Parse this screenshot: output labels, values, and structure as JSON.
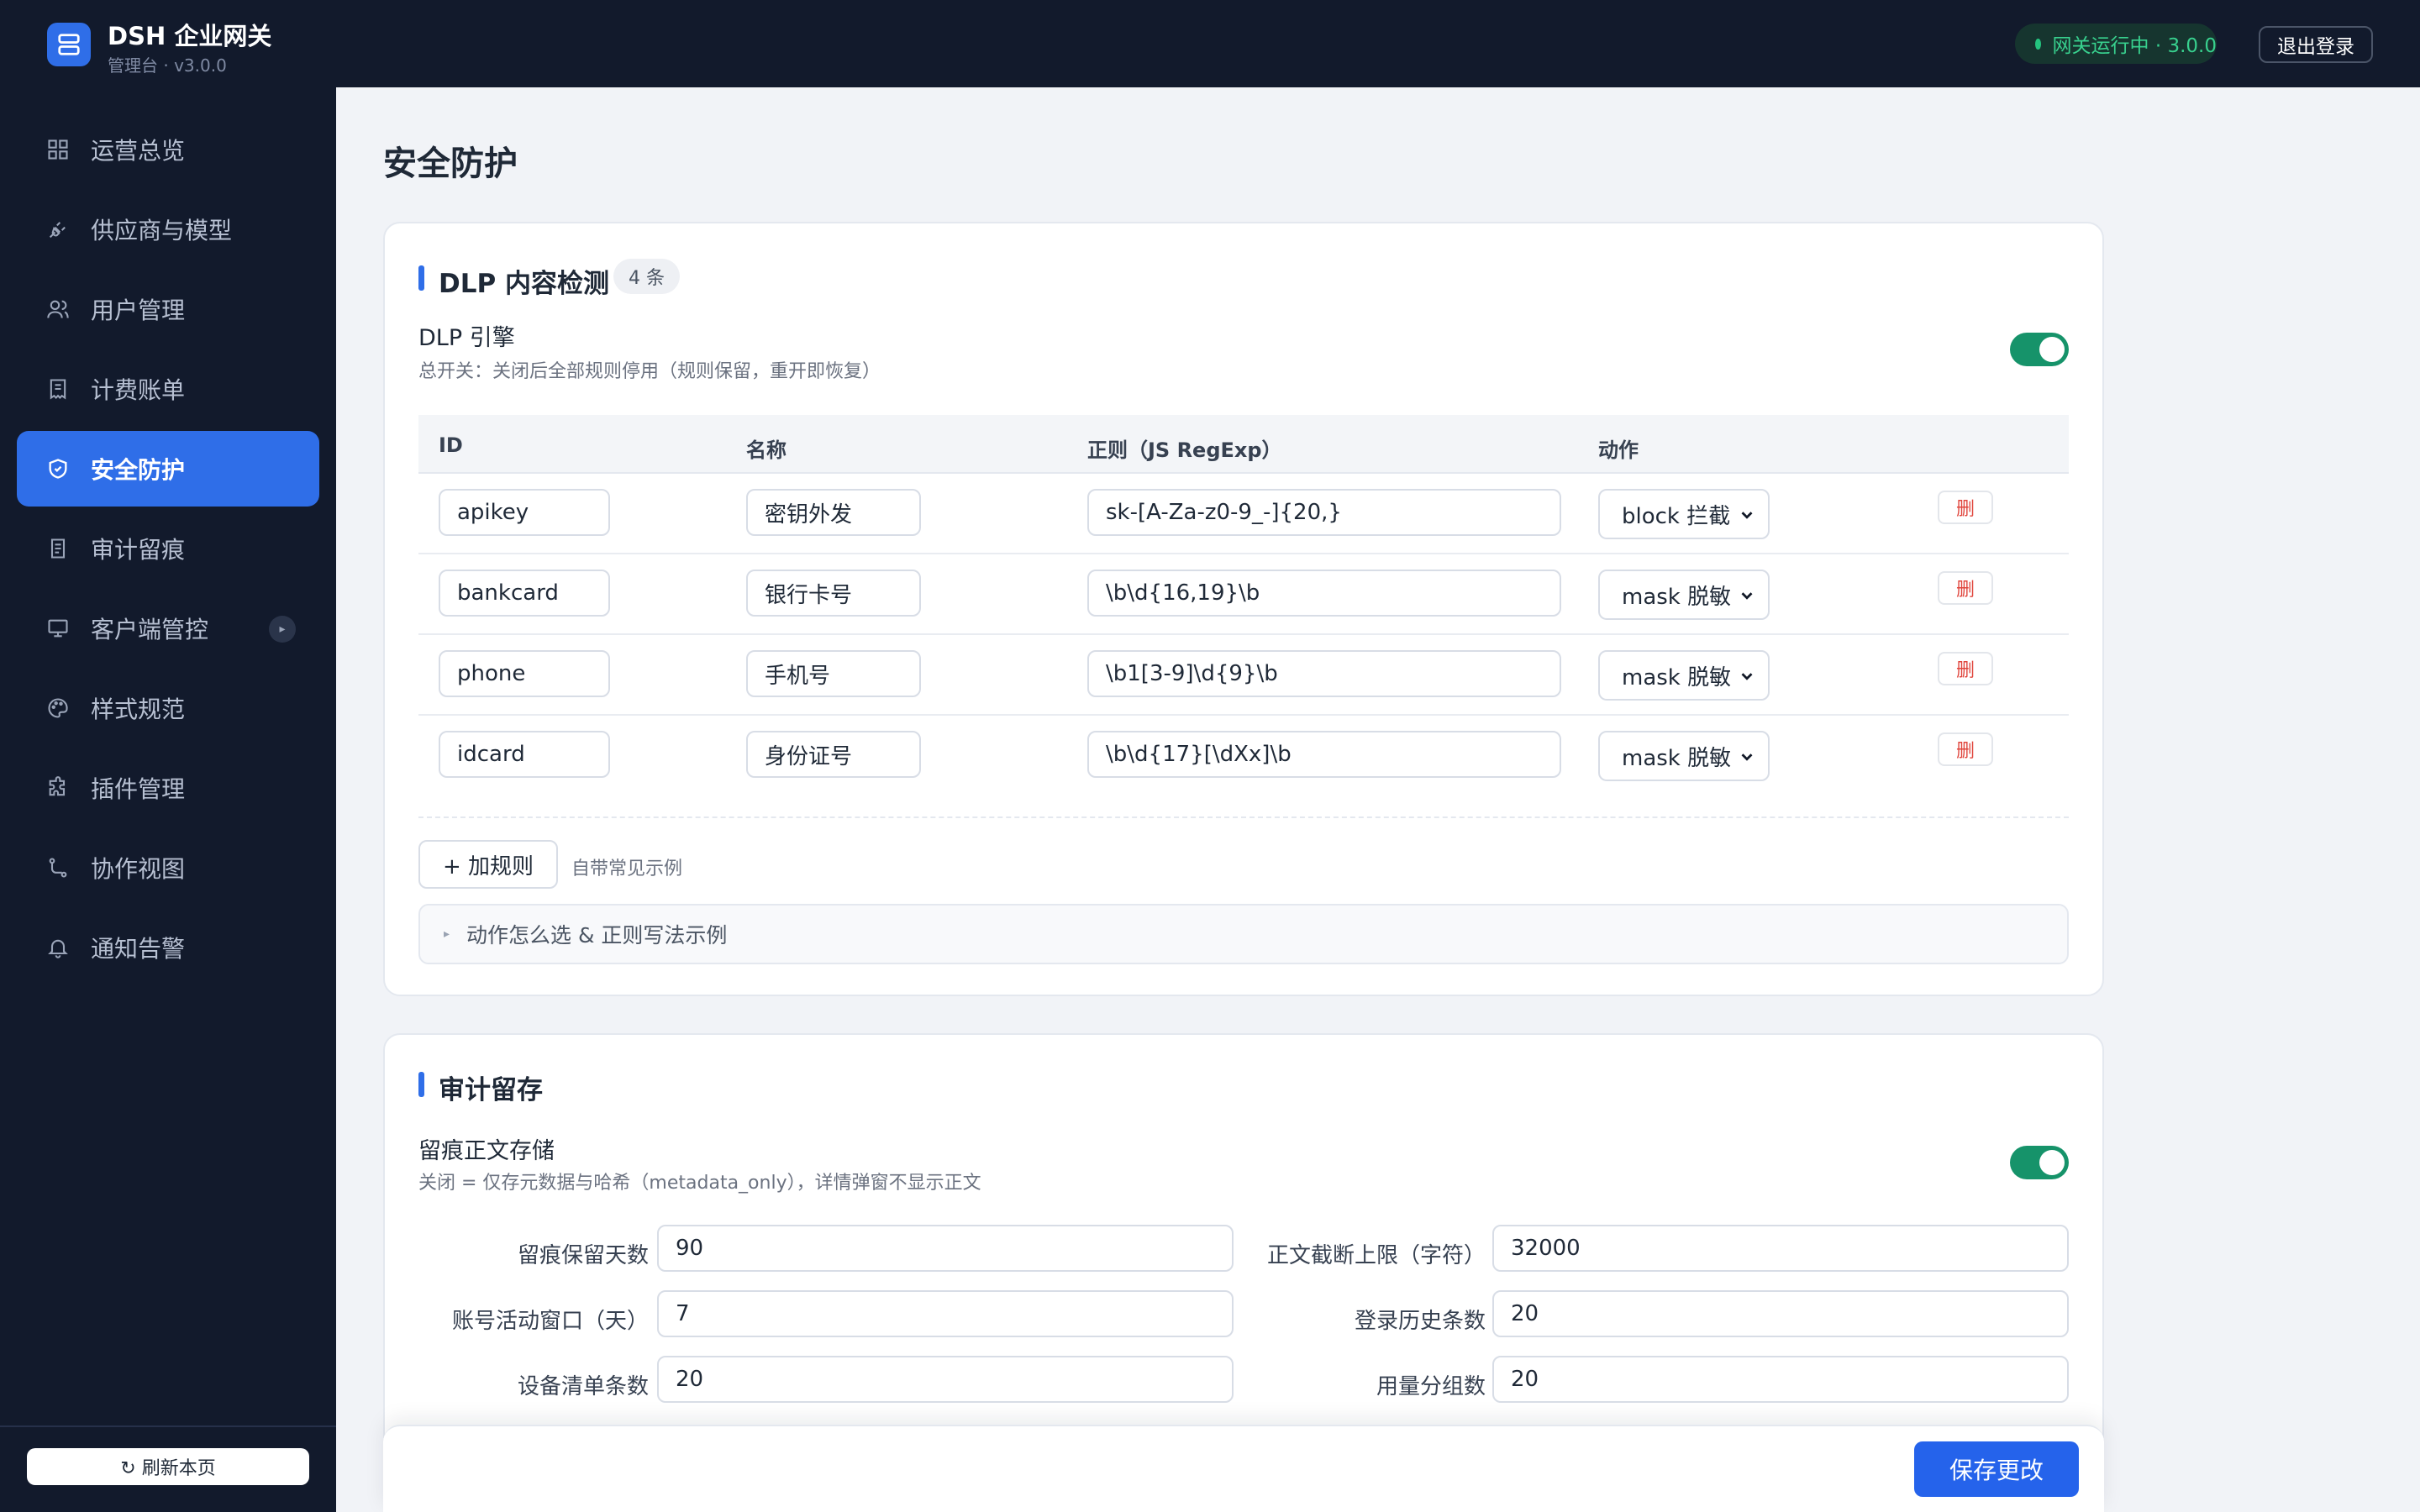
{
  "app": {
    "title": "DSH 企业网关",
    "subtitle": "管理台 · v3.0.0"
  },
  "header": {
    "status": "网关运行中 · 3.0.0",
    "logout": "退出登录"
  },
  "sidebar": {
    "items": [
      {
        "label": "运营总览",
        "icon": "dashboard-icon"
      },
      {
        "label": "供应商与模型",
        "icon": "plug-icon"
      },
      {
        "label": "用户管理",
        "icon": "users-icon"
      },
      {
        "label": "计费账单",
        "icon": "receipt-icon"
      },
      {
        "label": "安全防护",
        "icon": "shield-icon",
        "active": true
      },
      {
        "label": "审计留痕",
        "icon": "audit-icon"
      },
      {
        "label": "客户端管控",
        "icon": "monitor-icon",
        "badge": "▸"
      },
      {
        "label": "样式规范",
        "icon": "palette-icon"
      },
      {
        "label": "插件管理",
        "icon": "puzzle-icon"
      },
      {
        "label": "协作视图",
        "icon": "route-icon"
      },
      {
        "label": "通知告警",
        "icon": "bell-icon"
      }
    ],
    "refresh": "↻ 刷新本页"
  },
  "page": {
    "title": "安全防护"
  },
  "dlp": {
    "title": "DLP 内容检测",
    "count": "4 条",
    "engine_label": "DLP 引擎",
    "engine_desc": "总开关：关闭后全部规则停用（规则保留，重开即恢复）",
    "engine_enabled": true,
    "columns": {
      "id": "ID",
      "name": "名称",
      "regex": "正则（JS RegExp）",
      "action": "动作"
    },
    "rules": [
      {
        "id": "apikey",
        "name": "密钥外发",
        "regex": "sk-[A-Za-z0-9_-]{20,}",
        "action": "block 拦截",
        "delete": "删"
      },
      {
        "id": "bankcard",
        "name": "银行卡号",
        "regex": "\\b\\d{16,19}\\b",
        "action": "mask 脱敏",
        "delete": "删"
      },
      {
        "id": "phone",
        "name": "手机号",
        "regex": "\\b1[3-9]\\d{9}\\b",
        "action": "mask 脱敏",
        "delete": "删"
      },
      {
        "id": "idcard",
        "name": "身份证号",
        "regex": "\\b\\d{17}[\\dXx]\\b",
        "action": "mask 脱敏",
        "delete": "删"
      }
    ],
    "add_rule": "+ 加规则",
    "add_hint": "自带常见示例",
    "help_summary": "动作怎么选 & 正则写法示例"
  },
  "audit": {
    "title": "审计留存",
    "body_label": "留痕正文存储",
    "body_desc": "关闭 = 仅存元数据与哈希（metadata_only），详情弹窗不显示正文",
    "body_enabled": true,
    "fields": {
      "retention_days": {
        "label": "留痕保留天数",
        "value": "90"
      },
      "body_truncate": {
        "label": "正文截断上限（字符）",
        "value": "32000"
      },
      "activity_window": {
        "label": "账号活动窗口（天）",
        "value": "7"
      },
      "login_history": {
        "label": "登录历史条数",
        "value": "20"
      },
      "device_list": {
        "label": "设备清单条数",
        "value": "20"
      },
      "usage_groups": {
        "label": "用量分组数",
        "value": "20"
      }
    }
  },
  "footer": {
    "save": "保存更改"
  },
  "colors": {
    "accent": "#2f6ee8",
    "sidebar_bg": "#121a2c",
    "toggle_on": "#16936a",
    "danger": "#e0453c",
    "status_ok": "#24c47e"
  }
}
